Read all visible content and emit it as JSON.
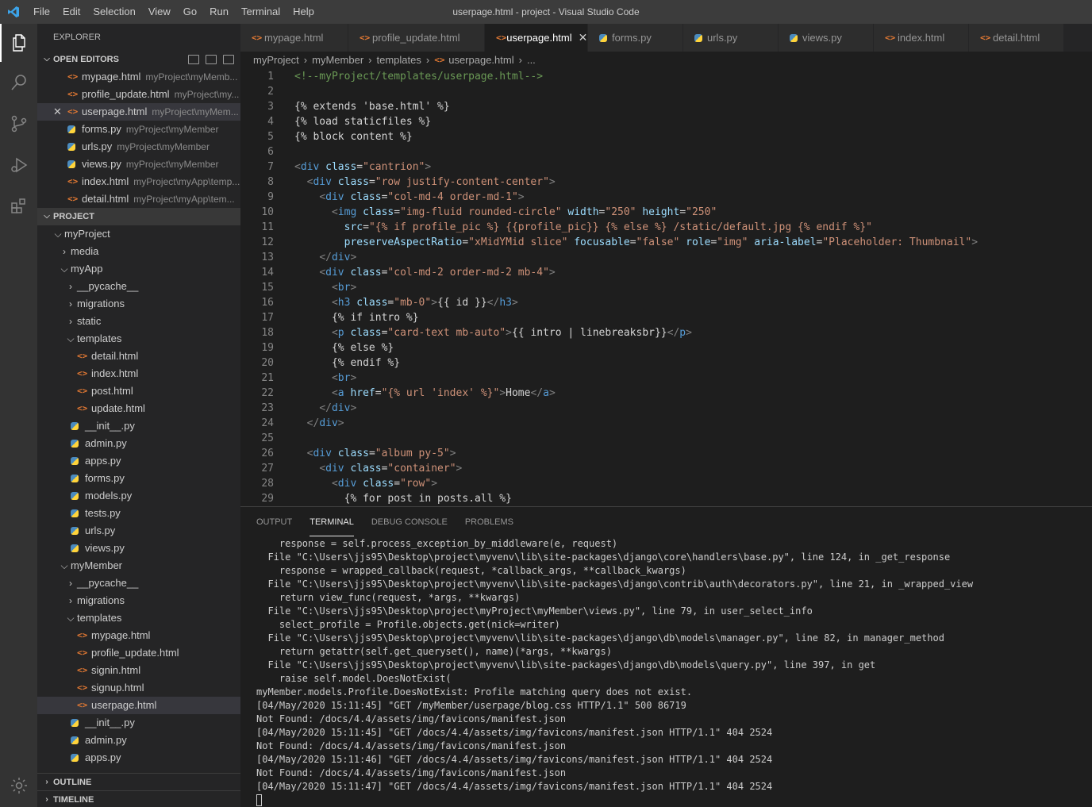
{
  "window": {
    "title": "userpage.html - project - Visual Studio Code",
    "menu": [
      "File",
      "Edit",
      "Selection",
      "View",
      "Go",
      "Run",
      "Terminal",
      "Help"
    ]
  },
  "sidebar": {
    "title": "EXPLORER",
    "open_editors_label": "OPEN EDITORS",
    "project_label": "PROJECT",
    "outline_label": "OUTLINE",
    "timeline_label": "TIMELINE",
    "open_editors": [
      {
        "name": "mypage.html",
        "desc": "myProject\\myMemb...",
        "type": "html"
      },
      {
        "name": "profile_update.html",
        "desc": "myProject\\my...",
        "type": "html"
      },
      {
        "name": "userpage.html",
        "desc": "myProject\\myMem...",
        "type": "html"
      },
      {
        "name": "forms.py",
        "desc": "myProject\\myMember",
        "type": "py"
      },
      {
        "name": "urls.py",
        "desc": "myProject\\myMember",
        "type": "py"
      },
      {
        "name": "views.py",
        "desc": "myProject\\myMember",
        "type": "py"
      },
      {
        "name": "index.html",
        "desc": "myProject\\myApp\\temp...",
        "type": "html"
      },
      {
        "name": "detail.html",
        "desc": "myProject\\myApp\\tem...",
        "type": "html"
      }
    ],
    "tree": [
      {
        "name": "myProject",
        "kind": "folder",
        "open": true
      },
      {
        "name": "media",
        "kind": "folder",
        "open": false
      },
      {
        "name": "myApp",
        "kind": "folder",
        "open": true
      },
      {
        "name": "__pycache__",
        "kind": "folder",
        "open": false
      },
      {
        "name": "migrations",
        "kind": "folder",
        "open": false
      },
      {
        "name": "static",
        "kind": "folder",
        "open": false
      },
      {
        "name": "templates",
        "kind": "folder",
        "open": true
      },
      {
        "name": "detail.html",
        "kind": "html"
      },
      {
        "name": "index.html",
        "kind": "html"
      },
      {
        "name": "post.html",
        "kind": "html"
      },
      {
        "name": "update.html",
        "kind": "html"
      },
      {
        "name": "__init__.py",
        "kind": "py"
      },
      {
        "name": "admin.py",
        "kind": "py"
      },
      {
        "name": "apps.py",
        "kind": "py"
      },
      {
        "name": "forms.py",
        "kind": "py"
      },
      {
        "name": "models.py",
        "kind": "py"
      },
      {
        "name": "tests.py",
        "kind": "py"
      },
      {
        "name": "urls.py",
        "kind": "py"
      },
      {
        "name": "views.py",
        "kind": "py"
      },
      {
        "name": "myMember",
        "kind": "folder",
        "open": true
      },
      {
        "name": "__pycache__",
        "kind": "folder",
        "open": false
      },
      {
        "name": "migrations",
        "kind": "folder",
        "open": false
      },
      {
        "name": "templates",
        "kind": "folder",
        "open": true
      },
      {
        "name": "mypage.html",
        "kind": "html"
      },
      {
        "name": "profile_update.html",
        "kind": "html"
      },
      {
        "name": "signin.html",
        "kind": "html"
      },
      {
        "name": "signup.html",
        "kind": "html"
      },
      {
        "name": "userpage.html",
        "kind": "html"
      },
      {
        "name": "__init__.py",
        "kind": "py"
      },
      {
        "name": "admin.py",
        "kind": "py"
      },
      {
        "name": "apps.py",
        "kind": "py"
      }
    ]
  },
  "tabs": [
    {
      "label": "mypage.html",
      "type": "html"
    },
    {
      "label": "profile_update.html",
      "type": "html"
    },
    {
      "label": "userpage.html",
      "type": "html",
      "active": true
    },
    {
      "label": "forms.py",
      "type": "py"
    },
    {
      "label": "urls.py",
      "type": "py"
    },
    {
      "label": "views.py",
      "type": "py"
    },
    {
      "label": "index.html",
      "type": "html"
    },
    {
      "label": "detail.html",
      "type": "html"
    }
  ],
  "breadcrumb": [
    "myProject",
    "myMember",
    "templates",
    "userpage.html",
    "..."
  ],
  "code": [
    [
      [
        "cm",
        "<!--myProject/templates/userpage.html-->"
      ]
    ],
    [],
    [
      [
        "tx",
        "{% extends 'base.html' %}"
      ]
    ],
    [
      [
        "tx",
        "{% load staticfiles %}"
      ]
    ],
    [
      [
        "tx",
        "{% block content %}"
      ]
    ],
    [],
    [
      [
        "br",
        "<"
      ],
      [
        "tag",
        "div"
      ],
      [
        "tx",
        " "
      ],
      [
        "attr",
        "class"
      ],
      [
        "tx",
        "="
      ],
      [
        "str",
        "\"cantrion\""
      ],
      [
        "br",
        ">"
      ]
    ],
    [
      [
        "tx",
        "  "
      ],
      [
        "br",
        "<"
      ],
      [
        "tag",
        "div"
      ],
      [
        "tx",
        " "
      ],
      [
        "attr",
        "class"
      ],
      [
        "tx",
        "="
      ],
      [
        "str",
        "\"row justify-content-center\""
      ],
      [
        "br",
        ">"
      ]
    ],
    [
      [
        "tx",
        "    "
      ],
      [
        "br",
        "<"
      ],
      [
        "tag",
        "div"
      ],
      [
        "tx",
        " "
      ],
      [
        "attr",
        "class"
      ],
      [
        "tx",
        "="
      ],
      [
        "str",
        "\"col-md-4 order-md-1\""
      ],
      [
        "br",
        ">"
      ]
    ],
    [
      [
        "tx",
        "      "
      ],
      [
        "br",
        "<"
      ],
      [
        "tag",
        "img"
      ],
      [
        "tx",
        " "
      ],
      [
        "attr",
        "class"
      ],
      [
        "tx",
        "="
      ],
      [
        "str",
        "\"img-fluid rounded-circle\""
      ],
      [
        "tx",
        " "
      ],
      [
        "attr",
        "width"
      ],
      [
        "tx",
        "="
      ],
      [
        "str",
        "\"250\""
      ],
      [
        "tx",
        " "
      ],
      [
        "attr",
        "height"
      ],
      [
        "tx",
        "="
      ],
      [
        "str",
        "\"250\""
      ]
    ],
    [
      [
        "tx",
        "        "
      ],
      [
        "attr",
        "src"
      ],
      [
        "tx",
        "="
      ],
      [
        "str",
        "\"{% if profile_pic %} {{profile_pic}} {% else %} /static/default.jpg {% endif %}\""
      ]
    ],
    [
      [
        "tx",
        "        "
      ],
      [
        "attr",
        "preserveAspectRatio"
      ],
      [
        "tx",
        "="
      ],
      [
        "str",
        "\"xMidYMid slice\""
      ],
      [
        "tx",
        " "
      ],
      [
        "attr",
        "focusable"
      ],
      [
        "tx",
        "="
      ],
      [
        "str",
        "\"false\""
      ],
      [
        "tx",
        " "
      ],
      [
        "attr",
        "role"
      ],
      [
        "tx",
        "="
      ],
      [
        "str",
        "\"img\""
      ],
      [
        "tx",
        " "
      ],
      [
        "attr",
        "aria-label"
      ],
      [
        "tx",
        "="
      ],
      [
        "str",
        "\"Placeholder: Thumbnail\""
      ],
      [
        "br",
        ">"
      ]
    ],
    [
      [
        "tx",
        "    "
      ],
      [
        "br",
        "</"
      ],
      [
        "tag",
        "div"
      ],
      [
        "br",
        ">"
      ]
    ],
    [
      [
        "tx",
        "    "
      ],
      [
        "br",
        "<"
      ],
      [
        "tag",
        "div"
      ],
      [
        "tx",
        " "
      ],
      [
        "attr",
        "class"
      ],
      [
        "tx",
        "="
      ],
      [
        "str",
        "\"col-md-2 order-md-2 mb-4\""
      ],
      [
        "br",
        ">"
      ]
    ],
    [
      [
        "tx",
        "      "
      ],
      [
        "br",
        "<"
      ],
      [
        "tag",
        "br"
      ],
      [
        "br",
        ">"
      ]
    ],
    [
      [
        "tx",
        "      "
      ],
      [
        "br",
        "<"
      ],
      [
        "tag",
        "h3"
      ],
      [
        "tx",
        " "
      ],
      [
        "attr",
        "class"
      ],
      [
        "tx",
        "="
      ],
      [
        "str",
        "\"mb-0\""
      ],
      [
        "br",
        ">"
      ],
      [
        "tx",
        "{{ id }}"
      ],
      [
        "br",
        "</"
      ],
      [
        "tag",
        "h3"
      ],
      [
        "br",
        ">"
      ]
    ],
    [
      [
        "tx",
        "      {% if intro %}"
      ]
    ],
    [
      [
        "tx",
        "      "
      ],
      [
        "br",
        "<"
      ],
      [
        "tag",
        "p"
      ],
      [
        "tx",
        " "
      ],
      [
        "attr",
        "class"
      ],
      [
        "tx",
        "="
      ],
      [
        "str",
        "\"card-text mb-auto\""
      ],
      [
        "br",
        ">"
      ],
      [
        "tx",
        "{{ intro | linebreaksbr}}"
      ],
      [
        "br",
        "</"
      ],
      [
        "tag",
        "p"
      ],
      [
        "br",
        ">"
      ]
    ],
    [
      [
        "tx",
        "      {% else %}"
      ]
    ],
    [
      [
        "tx",
        "      {% endif %}"
      ]
    ],
    [
      [
        "tx",
        "      "
      ],
      [
        "br",
        "<"
      ],
      [
        "tag",
        "br"
      ],
      [
        "br",
        ">"
      ]
    ],
    [
      [
        "tx",
        "      "
      ],
      [
        "br",
        "<"
      ],
      [
        "tag",
        "a"
      ],
      [
        "tx",
        " "
      ],
      [
        "attr",
        "href"
      ],
      [
        "tx",
        "="
      ],
      [
        "str",
        "\"{% url 'index' %}\""
      ],
      [
        "br",
        ">"
      ],
      [
        "tx",
        "Home"
      ],
      [
        "br",
        "</"
      ],
      [
        "tag",
        "a"
      ],
      [
        "br",
        ">"
      ]
    ],
    [
      [
        "tx",
        "    "
      ],
      [
        "br",
        "</"
      ],
      [
        "tag",
        "div"
      ],
      [
        "br",
        ">"
      ]
    ],
    [
      [
        "tx",
        "  "
      ],
      [
        "br",
        "</"
      ],
      [
        "tag",
        "div"
      ],
      [
        "br",
        ">"
      ]
    ],
    [],
    [
      [
        "tx",
        "  "
      ],
      [
        "br",
        "<"
      ],
      [
        "tag",
        "div"
      ],
      [
        "tx",
        " "
      ],
      [
        "attr",
        "class"
      ],
      [
        "tx",
        "="
      ],
      [
        "str",
        "\"album py-5\""
      ],
      [
        "br",
        ">"
      ]
    ],
    [
      [
        "tx",
        "    "
      ],
      [
        "br",
        "<"
      ],
      [
        "tag",
        "div"
      ],
      [
        "tx",
        " "
      ],
      [
        "attr",
        "class"
      ],
      [
        "tx",
        "="
      ],
      [
        "str",
        "\"container\""
      ],
      [
        "br",
        ">"
      ]
    ],
    [
      [
        "tx",
        "      "
      ],
      [
        "br",
        "<"
      ],
      [
        "tag",
        "div"
      ],
      [
        "tx",
        " "
      ],
      [
        "attr",
        "class"
      ],
      [
        "tx",
        "="
      ],
      [
        "str",
        "\"row\""
      ],
      [
        "br",
        ">"
      ]
    ],
    [
      [
        "tx",
        "        {% for post in posts.all %}"
      ]
    ]
  ],
  "panel": {
    "tabs": [
      "OUTPUT",
      "TERMINAL",
      "DEBUG CONSOLE",
      "PROBLEMS"
    ],
    "active": 1,
    "terminal": [
      "    response = self.process_exception_by_middleware(e, request)",
      "  File \"C:\\Users\\jjs95\\Desktop\\project\\myvenv\\lib\\site-packages\\django\\core\\handlers\\base.py\", line 124, in _get_response",
      "    response = wrapped_callback(request, *callback_args, **callback_kwargs)",
      "  File \"C:\\Users\\jjs95\\Desktop\\project\\myvenv\\lib\\site-packages\\django\\contrib\\auth\\decorators.py\", line 21, in _wrapped_view",
      "    return view_func(request, *args, **kwargs)",
      "  File \"C:\\Users\\jjs95\\Desktop\\project\\myProject\\myMember\\views.py\", line 79, in user_select_info",
      "    select_profile = Profile.objects.get(nick=writer)",
      "  File \"C:\\Users\\jjs95\\Desktop\\project\\myvenv\\lib\\site-packages\\django\\db\\models\\manager.py\", line 82, in manager_method",
      "    return getattr(self.get_queryset(), name)(*args, **kwargs)",
      "  File \"C:\\Users\\jjs95\\Desktop\\project\\myvenv\\lib\\site-packages\\django\\db\\models\\query.py\", line 397, in get",
      "    raise self.model.DoesNotExist(",
      "myMember.models.Profile.DoesNotExist: Profile matching query does not exist.",
      "[04/May/2020 15:11:45] \"GET /myMember/userpage/blog.css HTTP/1.1\" 500 86719",
      "Not Found: /docs/4.4/assets/img/favicons/manifest.json",
      "[04/May/2020 15:11:45] \"GET /docs/4.4/assets/img/favicons/manifest.json HTTP/1.1\" 404 2524",
      "Not Found: /docs/4.4/assets/img/favicons/manifest.json",
      "[04/May/2020 15:11:46] \"GET /docs/4.4/assets/img/favicons/manifest.json HTTP/1.1\" 404 2524",
      "Not Found: /docs/4.4/assets/img/favicons/manifest.json",
      "[04/May/2020 15:11:47] \"GET /docs/4.4/assets/img/favicons/manifest.json HTTP/1.1\" 404 2524"
    ]
  },
  "icons": {
    "files": "files-icon",
    "search": "search-icon",
    "scm": "source-control-icon",
    "debug": "run-debug-icon",
    "extensions": "extensions-icon",
    "settings": "gear-icon"
  }
}
